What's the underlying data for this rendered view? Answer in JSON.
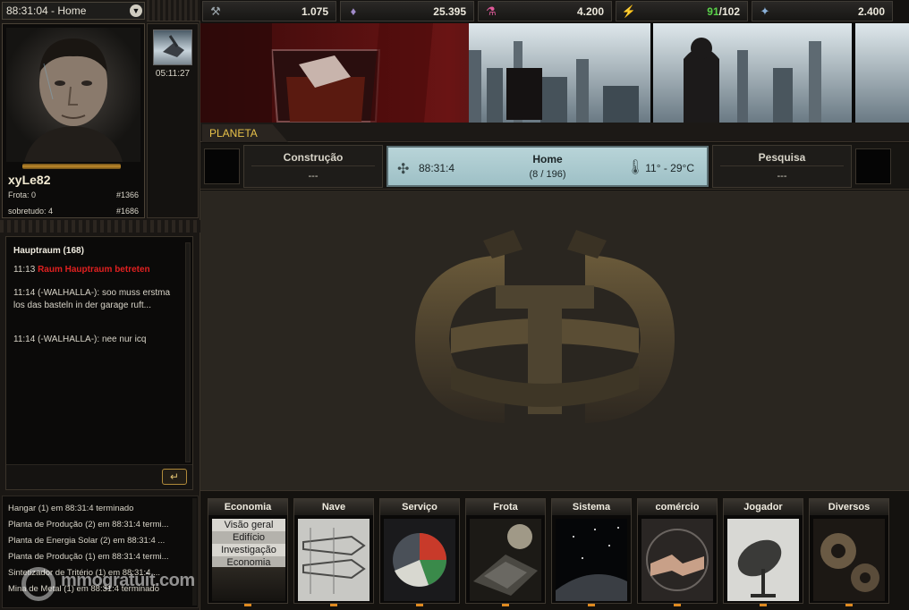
{
  "planet_selector": {
    "label": "88:31:04 - Home",
    "dropdown_icon": "chevron-down-icon"
  },
  "player": {
    "username": "xyLe82",
    "fleet_label": "Frota: 0",
    "fleet_rank": "#1366",
    "overall_label": "sobretudo: 4",
    "overall_rank": "#1686"
  },
  "mini_panel": {
    "timer": "05:11:27"
  },
  "resources": [
    {
      "icon": "metal-icon",
      "value": "1.075"
    },
    {
      "icon": "crystal-icon",
      "value": "25.395"
    },
    {
      "icon": "tritium-icon",
      "value": "4.200"
    },
    {
      "icon": "energy-icon",
      "value_used": "91",
      "value_total": "/102"
    },
    {
      "icon": "credits-icon",
      "value": "2.400"
    }
  ],
  "planet_tab": "PLANETA",
  "construction": {
    "title": "Construção",
    "value": "---"
  },
  "home": {
    "title": "Home",
    "count": "(8 / 196)",
    "coords": "88:31:4",
    "temp": "11° -  29°C"
  },
  "research": {
    "title": "Pesquisa",
    "value": "---"
  },
  "chat": {
    "room": "Hauptraum (168)",
    "messages": [
      {
        "time": "11:13",
        "text": "Raum Hauptraum betreten",
        "system": true
      },
      {
        "time": "11:14",
        "text": "(-WALHALLA-): soo muss erstma los das basteln in der garage ruft...",
        "system": false
      },
      {
        "time": "11:14",
        "text": "(-WALHALLA-): nee nur icq",
        "system": false
      }
    ],
    "send_icon": "return-arrow-icon"
  },
  "log": [
    "Hangar (1) em 88:31:4 terminado",
    "Planta de Produção (2) em 88:31:4 termi...",
    "Planta de Energia Solar (2) em 88:31:4 ...",
    "Planta de Produção (1) em 88:31:4 termi...",
    "Sintetizador de Tritério (1) em 88:31:4 ...",
    "Mina de Metal (1) em 88:31:4 terminado"
  ],
  "menu": [
    {
      "label": "Economia",
      "sub": [
        "Visão geral",
        "Edifício",
        "Investigação",
        "Economia"
      ]
    },
    {
      "label": "Nave"
    },
    {
      "label": "Serviço"
    },
    {
      "label": "Frota"
    },
    {
      "label": "Sistema"
    },
    {
      "label": "comércio"
    },
    {
      "label": "Jogador"
    },
    {
      "label": "Diversos"
    }
  ],
  "watermark": "mmogratuit.com",
  "colors": {
    "accent": "#e8c24a",
    "alert": "#e02020",
    "energy_ok": "#5ad24a",
    "home_panel": "#b8d4d8"
  }
}
